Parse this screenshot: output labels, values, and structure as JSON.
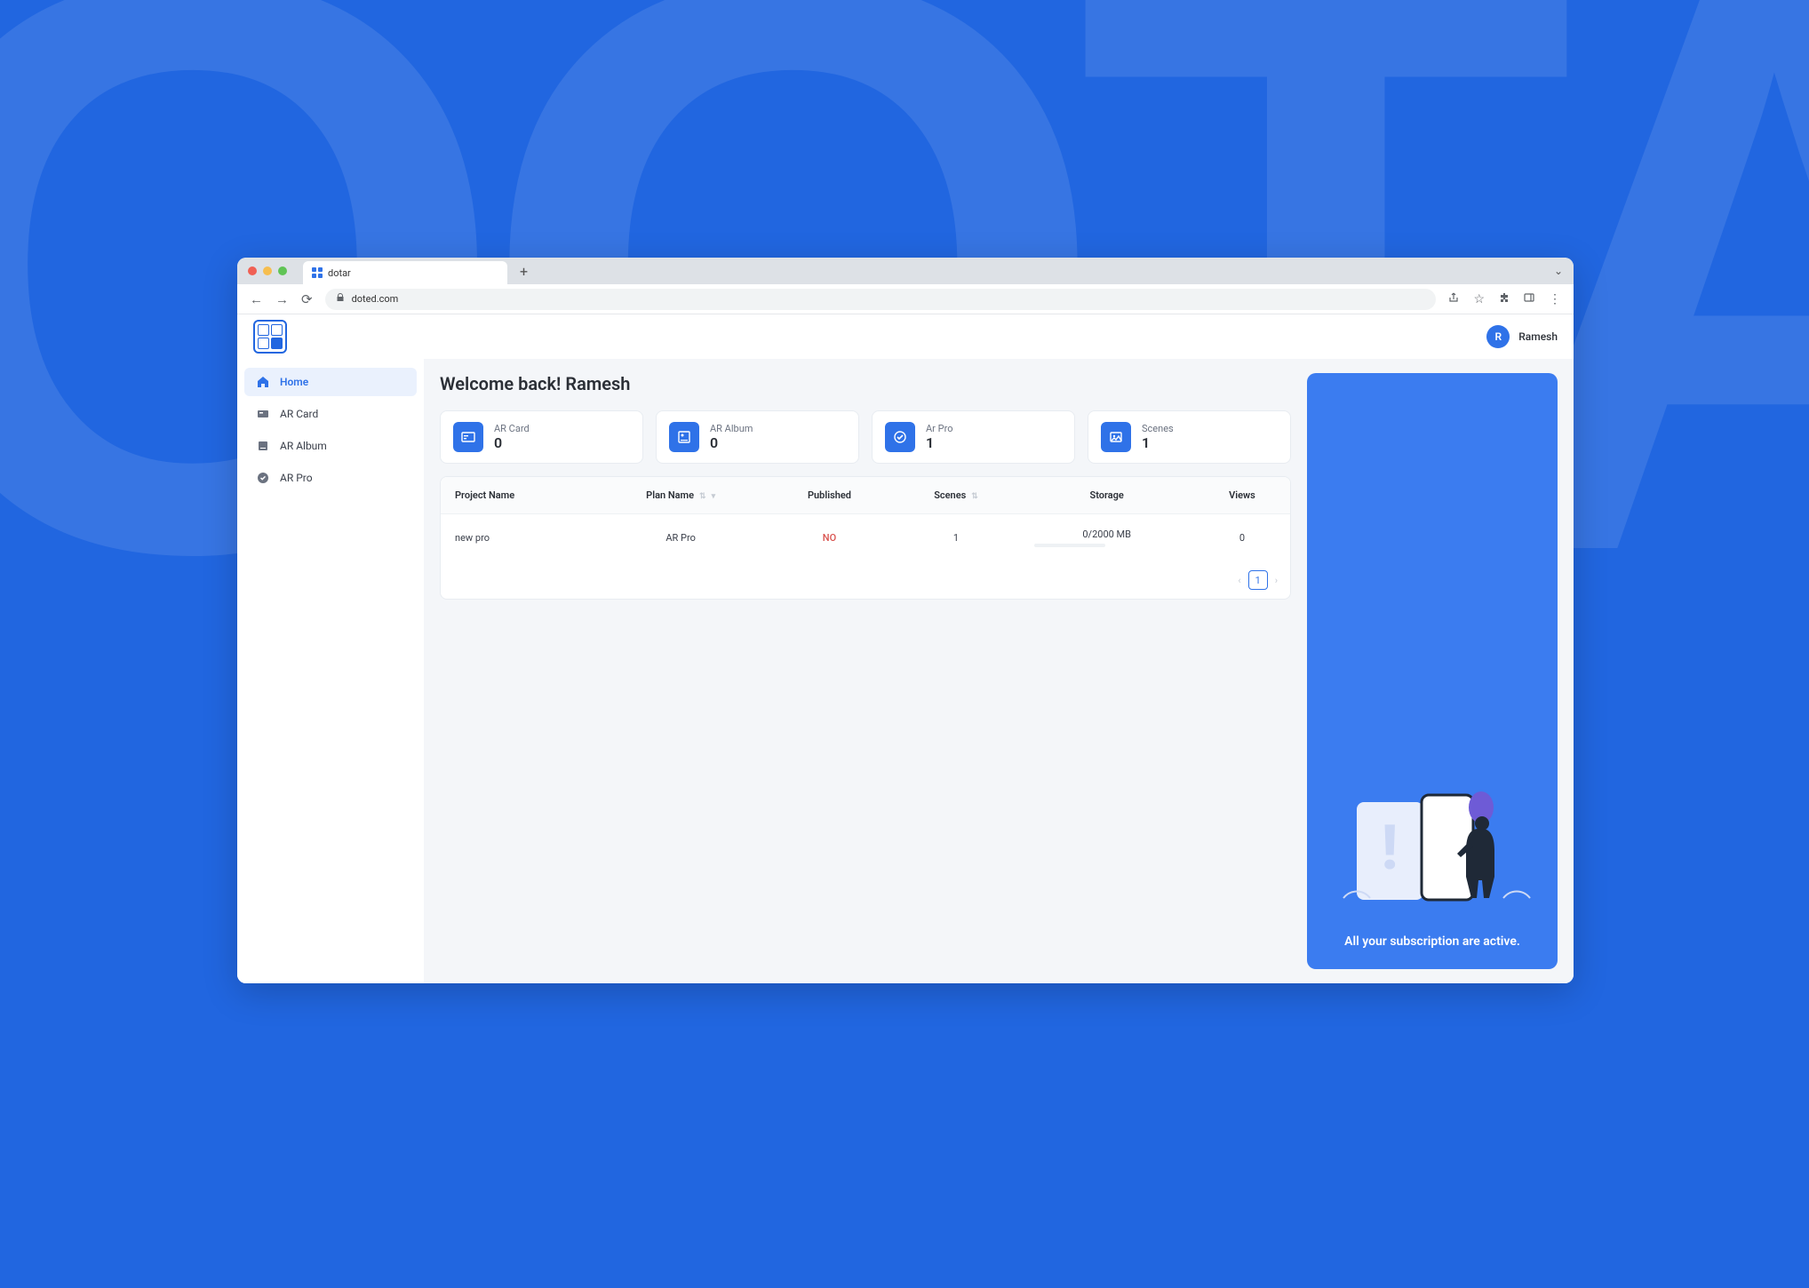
{
  "browser": {
    "tab_title": "dotar",
    "url": "doted.com"
  },
  "user": {
    "initial": "R",
    "name": "Ramesh"
  },
  "sidebar": {
    "items": [
      {
        "label": "Home"
      },
      {
        "label": "AR Card"
      },
      {
        "label": "AR Album"
      },
      {
        "label": "AR Pro"
      }
    ]
  },
  "welcome": "Welcome back! Ramesh",
  "stats": [
    {
      "label": "AR Card",
      "value": "0"
    },
    {
      "label": "AR Album",
      "value": "0"
    },
    {
      "label": "Ar Pro",
      "value": "1"
    },
    {
      "label": "Scenes",
      "value": "1"
    }
  ],
  "table": {
    "headers": {
      "project": "Project Name",
      "plan": "Plan Name",
      "published": "Published",
      "scenes": "Scenes",
      "storage": "Storage",
      "views": "Views"
    },
    "rows": [
      {
        "project": "new pro",
        "plan": "AR Pro",
        "published": "NO",
        "scenes": "1",
        "storage": "0/2000 MB",
        "views": "0"
      }
    ],
    "page": "1"
  },
  "promo": {
    "message": "All your subscription are active."
  }
}
